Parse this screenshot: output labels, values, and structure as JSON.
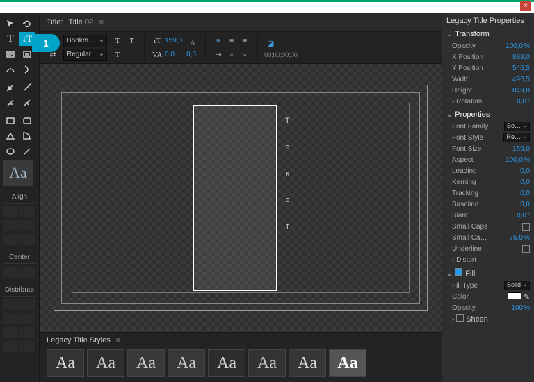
{
  "callout": "1",
  "title_label": "Title:",
  "title_name": "Title 02",
  "font_family": "Bookm…",
  "font_style_tb": "Regular",
  "tracking_val": "159,0",
  "tracking_val2": "0,0",
  "kerning_val": "0,0",
  "timecode": "00;00;00;00",
  "canvas_text": "Текст",
  "styles_header": "Legacy Title Styles",
  "swatches": [
    "Aa",
    "Aa",
    "Aa",
    "Aa",
    "Aa",
    "Aa",
    "Aa",
    "Aa"
  ],
  "aa_label": "Aa",
  "align_label": "Align",
  "center_label": "Center",
  "distribute_label": "Distribute",
  "props": {
    "header": "Legacy Title Properties",
    "groups": {
      "transform": "Transform",
      "properties": "Properties",
      "fill": "Fill"
    },
    "opacity": {
      "l": "Opacity",
      "v": "100,0",
      "u": "%"
    },
    "xpos": {
      "l": "X Position",
      "v": "889,0"
    },
    "ypos": {
      "l": "Y Position",
      "v": "546,5"
    },
    "width": {
      "l": "Width",
      "v": "496,5"
    },
    "height": {
      "l": "Height",
      "v": "849,8"
    },
    "rotation": {
      "l": "Rotation",
      "v": "0,0",
      "u": "°"
    },
    "fontfam": {
      "l": "Font Family",
      "v": "Bo…"
    },
    "fontsty": {
      "l": "Font Style",
      "v": "Re…"
    },
    "fontsize": {
      "l": "Font Size",
      "v": "159,0"
    },
    "aspect": {
      "l": "Aspect",
      "v": "100,0",
      "u": "%"
    },
    "leading": {
      "l": "Leading",
      "v": "0,0"
    },
    "kerning": {
      "l": "Kerning",
      "v": "0,0"
    },
    "tracking": {
      "l": "Tracking",
      "v": "0,0"
    },
    "baseline": {
      "l": "Baseline …",
      "v": "0,0"
    },
    "slant": {
      "l": "Slant",
      "v": "0,0",
      "u": "°"
    },
    "smallcaps": {
      "l": "Small Caps"
    },
    "smallcapsz": {
      "l": "Small Ca…",
      "v": "75,0",
      "u": "%"
    },
    "underline": {
      "l": "Underline"
    },
    "distort": {
      "l": "Distort"
    },
    "filltype": {
      "l": "Fill Type",
      "v": "Solid"
    },
    "color": {
      "l": "Color"
    },
    "fopacity": {
      "l": "Opacity",
      "v": "100",
      "u": "%"
    },
    "sheen": {
      "l": "Sheen"
    }
  }
}
